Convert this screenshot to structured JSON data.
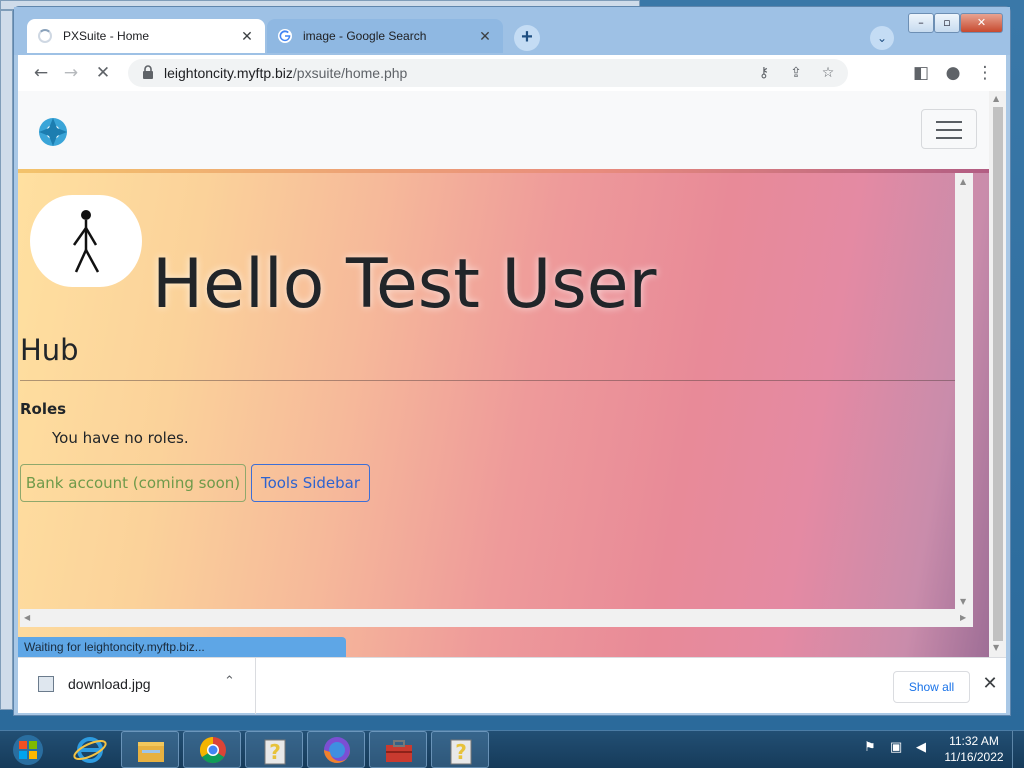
{
  "browser": {
    "tabs": [
      {
        "title": "PXSuite - Home",
        "active": true,
        "loading": true
      },
      {
        "title": "image - Google Search",
        "active": false,
        "favicon": "google-icon"
      }
    ],
    "url_host": "leightoncity.myftp.biz",
    "url_path": "/pxsuite/home.php",
    "status_text": "Waiting for leightoncity.myftp.biz..."
  },
  "page": {
    "greeting": "Hello Test User",
    "hub_title": "Hub",
    "roles_heading": "Roles",
    "roles_text": "You have no roles.",
    "buttons": {
      "bank": "Bank account (coming soon)",
      "tools": "Tools Sidebar"
    }
  },
  "downloads": {
    "file_name": "download.jpg",
    "show_all": "Show all"
  },
  "taskbar": {
    "apps": [
      "internet-explorer-icon",
      "file-explorer-icon",
      "chrome-icon",
      "help-icon",
      "firefox-icon",
      "toolbox-icon",
      "help-icon"
    ],
    "time": "11:32 AM",
    "date": "11/16/2022"
  },
  "colors": {
    "bank_button": "#6f9a4a",
    "tools_button": "#2e63cf",
    "status_bubble": "#5ea6e6"
  }
}
